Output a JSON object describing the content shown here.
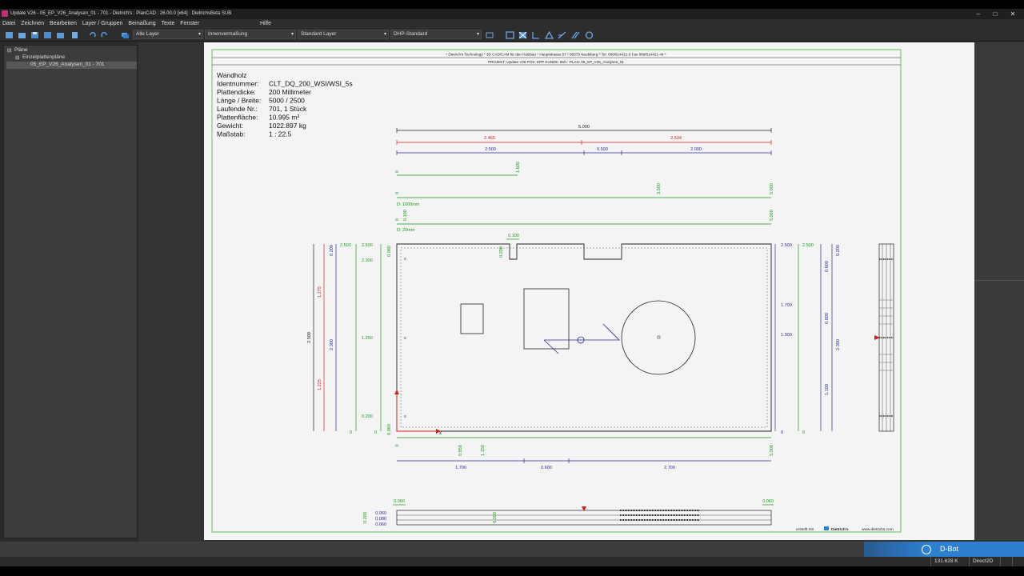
{
  "window": {
    "title": "Update V26 - 05_EP_V26_Analysen_01 - 701 - Dietrich's : PlanCAD : 26.00.0 [x64] :     DietrichsBeta SUB",
    "minimize": "–",
    "maximize": "□",
    "close": "✕"
  },
  "menu": {
    "items": [
      "Datei",
      "Zeichnen",
      "Bearbeiten",
      "Layer / Gruppen",
      "Bemaßung",
      "Texte",
      "Fenster"
    ],
    "help": "Hilfe"
  },
  "toolbar": {
    "layer_combo": "Alle Layer",
    "dim_combo": "Innenvermaßung",
    "std_layer_combo": "Standard Layer",
    "dhp_combo": "DHP-Standard"
  },
  "tree": {
    "root": "Pläne",
    "group": "Einzelplattenpläne",
    "selected": "05_EP_V26_Analysen_01 - 701"
  },
  "sheet": {
    "header_line1": "* Dietrich's Technology * 3D CAD/CAM für den Holzbau * Hauptstrasse 57 * 85579 Neubiberg * Tel. 089/614421-0  Fax 089/614421-44 *",
    "header_line2": "PROJEKT: Update V26    POS: EPP    KUNDE:    Bvh.:    PLAN: 05_EP_V26_Analysen_01",
    "info_title": "Wandholz",
    "info": [
      {
        "label": "Identnummer:",
        "value": "CLT_DQ_200_WSI/WSI_5s"
      },
      {
        "label": "Plattendicke:",
        "value": "200 Millimeter"
      },
      {
        "label": "Länge / Breite:",
        "value": "5000 / 2500"
      },
      {
        "label": "Laufende Nr.:",
        "value": "701,  1 Stück"
      },
      {
        "label": "Plattenfläche:",
        "value": "10.995 m²"
      },
      {
        "label": "Gewicht:",
        "value": "1022.897 kg"
      },
      {
        "label": "Maßstab:",
        "value": "1 : 22.5"
      }
    ],
    "footer_created": "erstellt mit",
    "footer_brand": "Dietrich's",
    "footer_url": "www.dietrichs.com"
  },
  "dims": {
    "top_total": "5.000",
    "red_a": "2.465",
    "red_b": "2.534",
    "blue_a": "2.500",
    "blue_b": "0.500",
    "blue_c": "2.000",
    "g1_start": "0",
    "g1_end": "1.600",
    "g2_start": "0",
    "g2_mid": "3.500",
    "g2_end": "5.000",
    "d1_label": "D: 1000mm",
    "g3_start": "0",
    "g3_a": "0.100",
    "g3_end": "5.000",
    "d2_label": "D: 20mm",
    "notch_w": "0.100",
    "notch_h": "0.200",
    "left_total": "2.500",
    "left_red_a": "1.275",
    "left_red_b": "1.225",
    "left_blue_a": "0.200",
    "left_blue_b": "2.300",
    "left_g_top": "2.500",
    "left_g_top2": "2.500",
    "left_g_b": "2.300",
    "left_g_mid": "1.250",
    "left_g_low": "0.200",
    "left_g_zero": "0",
    "left_g_zero2": "0",
    "left_small": "0.060",
    "left_small2": "0.060",
    "right_top": "2.500",
    "right_top2": "2.500",
    "right_a": "1.700",
    "right_b": "1.300",
    "right_zero": "0",
    "right_zero2": "0",
    "right_blue_a": "0.600",
    "right_blue_b": "0.800",
    "right_blue_c": "1.100",
    "right_blue_d": "0.200",
    "right_blue_e": "2.300",
    "bot_zero": "0",
    "bot_a": "0.850",
    "bot_b": "1.150",
    "bot_end": "5.000",
    "bot_blue_a": "1.700",
    "bot_blue_b": "0.600",
    "bot_blue_c": "2.700",
    "sec_a": "0.060",
    "sec_b": "0.060",
    "sec_l1": "0.060",
    "sec_l2": "0.080",
    "sec_l3": "0.060",
    "sec_total": "0.200",
    "sec_mid": "0.200",
    "axis_x": "x",
    "mark_b": "B"
  },
  "status": {
    "dbot": "D-Bot",
    "coords": "131.628 K",
    "renderer": "Direct2D"
  },
  "colors": {
    "dim_green": "#1a9a1a",
    "dim_red": "#d02020",
    "dim_blue": "#2a2a9a",
    "frame_green": "#33bb33"
  }
}
